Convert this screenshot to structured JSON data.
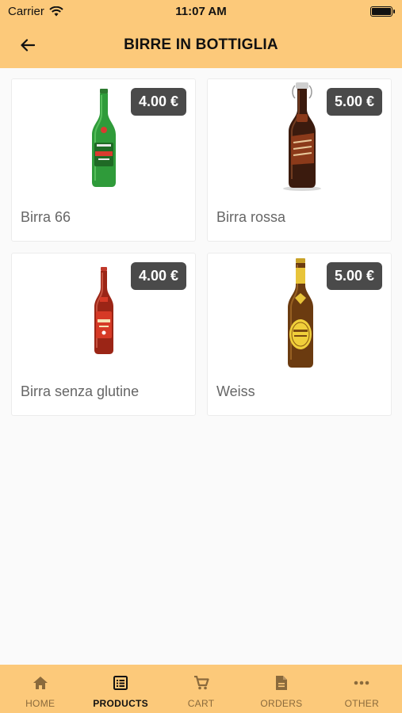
{
  "status_bar": {
    "carrier": "Carrier",
    "time": "11:07 AM"
  },
  "header": {
    "title": "BIRRE IN BOTTIGLIA",
    "back_icon": "arrow-left-icon"
  },
  "products": [
    {
      "name": "Birra 66",
      "price": "4.00 €",
      "image": "green-beer-bottle"
    },
    {
      "name": "Birra rossa",
      "price": "5.00 €",
      "image": "swing-top-dark-beer-bottle"
    },
    {
      "name": "Birra senza glutine",
      "price": "4.00 €",
      "image": "red-beer-bottle"
    },
    {
      "name": "Weiss",
      "price": "5.00 €",
      "image": "amber-weiss-beer-bottle"
    }
  ],
  "tabs": [
    {
      "label": "HOME",
      "icon": "home-icon",
      "active": false
    },
    {
      "label": "PRODUCTS",
      "icon": "list-icon",
      "active": true
    },
    {
      "label": "CART",
      "icon": "cart-icon",
      "active": false
    },
    {
      "label": "ORDERS",
      "icon": "document-icon",
      "active": false
    },
    {
      "label": "OTHER",
      "icon": "more-icon",
      "active": false
    }
  ],
  "colors": {
    "header_bg": "#fcc97a",
    "badge_bg": "#4a4a4a",
    "page_bg": "#fafafa"
  }
}
